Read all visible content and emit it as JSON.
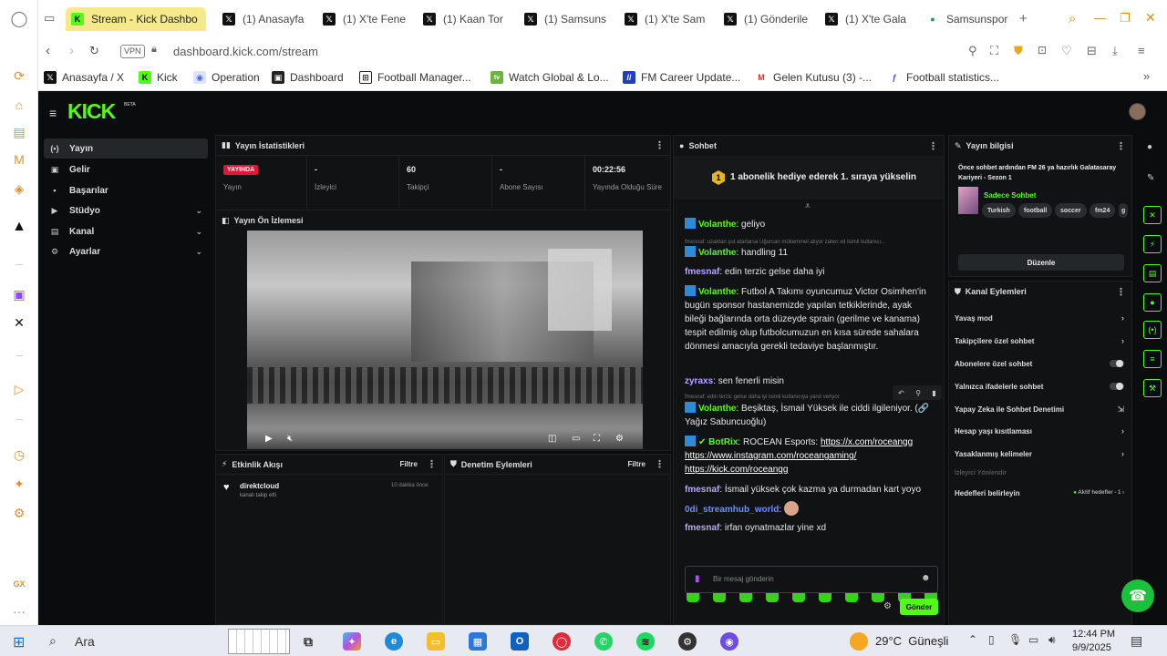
{
  "browser": {
    "tabs": [
      {
        "title": "Stream - Kick Dashbo",
        "icon": "kick",
        "active": true
      },
      {
        "title": "(1) Anasayfa",
        "icon": "x"
      },
      {
        "title": "(1) X'te Fene",
        "icon": "x"
      },
      {
        "title": "(1) Kaan Tor",
        "icon": "x"
      },
      {
        "title": "(1) Samsuns",
        "icon": "x"
      },
      {
        "title": "(1) X'te Sam",
        "icon": "x"
      },
      {
        "title": "(1) Gönderile",
        "icon": "x"
      },
      {
        "title": "(1) X'te Gala",
        "icon": "x"
      },
      {
        "title": "Samsunspor",
        "icon": "samsunspor"
      }
    ],
    "vpn_label": "VPN",
    "url": "dashboard.kick.com/stream",
    "bookmarks": [
      {
        "label": "Anasayfa / X",
        "icon": "x"
      },
      {
        "label": "Kick",
        "icon": "kick"
      },
      {
        "label": "Operation",
        "icon": "globe"
      },
      {
        "label": "Dashboard",
        "icon": "dashboard"
      },
      {
        "label": "Football Manager...",
        "icon": "fm"
      },
      {
        "label": "Watch Global & Lo...",
        "icon": "tv"
      },
      {
        "label": "FM Career Update...",
        "icon": "fm-blue"
      },
      {
        "label": "Gelen Kutusu (3) -...",
        "icon": "gmail"
      },
      {
        "label": "Football statistics...",
        "icon": "stats"
      }
    ]
  },
  "kick": {
    "logo": "KICK",
    "logo_badge": "BETA",
    "sidebar": [
      {
        "label": "Yayın",
        "icon": "broadcast-icon",
        "active": true
      },
      {
        "label": "Gelir",
        "icon": "money-icon"
      },
      {
        "label": "Başarılar",
        "icon": "trophy-icon"
      },
      {
        "label": "Stüdyo",
        "icon": "studio-icon",
        "chevron": true
      },
      {
        "label": "Kanal",
        "icon": "channel-icon",
        "chevron": true
      },
      {
        "label": "Ayarlar",
        "icon": "gear-icon",
        "chevron": true
      }
    ],
    "stats": {
      "title": "Yayın İstatistikleri",
      "live_badge": "YAYINDA",
      "items": [
        {
          "value": "",
          "label": "Yayın"
        },
        {
          "value": "-",
          "label": "İzleyici"
        },
        {
          "value": "60",
          "label": "Takipçi"
        },
        {
          "value": "-",
          "label": "Abone Sayısı"
        },
        {
          "value": "00:22:56",
          "label": "Yayında Olduğu Süre"
        }
      ]
    },
    "preview": {
      "title": "Yayın Ön İzlemesi"
    },
    "activity": {
      "title": "Etkinlik Akışı",
      "filter": "Filtre",
      "item_user": "direktcloud",
      "item_text": "kanalı takip etti",
      "item_time": "10 dakika önce"
    },
    "moderation": {
      "title": "Denetim Eylemleri",
      "filter": "Filtre"
    },
    "chat": {
      "title": "Sohbet",
      "banner": "1 abonelik hediye ederek 1. sıraya yükselin",
      "banner_num": "1",
      "msg1_user": "Volanthe",
      "msg1_text": " geliyo",
      "reply1": "fmesnaf: uzaktan şut atarlarsa Uğurcan mükemmel alıyor zaten xd isimli kullanıcı...",
      "msg2_user": "Volanthe",
      "msg2_text": " handling 11",
      "msg3_user": "fmesnaf",
      "msg3_text": " edin terzic gelse daha iyi",
      "msg4_user": "Volanthe",
      "msg4_text": " Futbol A Takımı oyuncumuz Victor Osimhen'in bugün sponsor hastanemizde yapılan tetkiklerinde, ayak bileği bağlarında orta düzeyde sprain (gerilme ve kanama) tespit edilmiş olup futbolcumuzun en kısa sürede sahalara dönmesi amacıyla gerekli tedaviye başlanmıştır.",
      "msg5_user": "zyraxs",
      "msg5_text": " sen fenerli misin",
      "reply2": "fmesnaf: edin terzic gelse daha iyi isimli kullanıcıya yanıt veriyor",
      "msg6_user": "Volanthe",
      "msg6_text": " Beşiktaş, İsmail Yüksek ile ciddi ilgileniyor. (🔗 Yağız Sabuncuoğlu)",
      "msg7_user": "BotRix",
      "msg7_text": " ROCEAN Esports: ",
      "msg7_link1": "https://x.com/roceangg",
      "msg7_link2": "https://www.instagram.com/roceangaming/",
      "msg7_link3": "https://kick.com/roceangg",
      "msg8_user": "fmesnaf",
      "msg8_text": " İsmail yüksek çok kazma ya durmadan kart yoyo",
      "msg9_user": "0di_streamhub_world",
      "msg9_text": "",
      "msg10_user": "fmesnaf",
      "msg10_text": " irfan oynatmazlar yine xd",
      "input_placeholder": "Bir mesaj gönderin",
      "send_label": "Gönder"
    },
    "stream_info": {
      "title": "Yayın bilgisi",
      "stream_title": "Önce sohbet ardından FM 26 ya hazırlık Galatasaray Kariyeri - Sezon 1",
      "category": "Sadece Sohbet",
      "tags": [
        "Turkish",
        "football",
        "soccer",
        "fm24",
        "g"
      ],
      "edit_label": "Düzenle"
    },
    "channel_actions": {
      "title": "Kanal Eylemleri",
      "rows": [
        {
          "label": "Yavaş mod",
          "control": "chevron"
        },
        {
          "label": "Takipçilere özel sohbet",
          "control": "chevron"
        },
        {
          "label": "Abonelere özel sohbet",
          "control": "toggle"
        },
        {
          "label": "Yalnızca ifadelerle sohbet",
          "control": "toggle"
        },
        {
          "label": "Yapay Zeka ile Sohbet Denetimi",
          "control": "external"
        },
        {
          "label": "Hesap yaşı kısıtlaması",
          "control": "chevron"
        },
        {
          "label": "Yasaklanmış kelimeler",
          "control": "chevron"
        }
      ],
      "section_label": "İzleyici Yönlendir",
      "goals_label": "Hedefleri belirleyin",
      "goals_status": "Aktif hedefler - 1"
    }
  },
  "taskbar": {
    "search_label": "Ara",
    "weather": "29°C  Güneşli",
    "time": "12:44 PM",
    "date": "9/9/2025"
  },
  "colors": {
    "kick_green": "#53fc18",
    "live_red": "#e3163a",
    "tab_active": "#f6e98a"
  }
}
